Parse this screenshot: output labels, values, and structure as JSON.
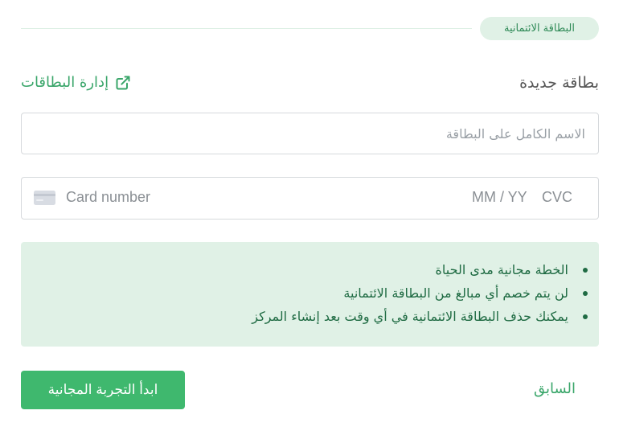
{
  "section": {
    "title": "البطاقة الائتمانية"
  },
  "header": {
    "new_card_title": "بطاقة جديدة",
    "manage_cards_link": "إدارة البطاقات"
  },
  "form": {
    "name_placeholder": "الاسم الكامل على البطاقة",
    "card_number_placeholder": "Card number",
    "expiry_placeholder": "MM / YY",
    "cvc_placeholder": "CVC"
  },
  "info": {
    "items": [
      "الخطة مجانية مدى الحياة",
      "لن يتم خصم أي مبالغ من البطاقة الائتمانية",
      "يمكنك حذف البطاقة الائتمانية في أي وقت بعد إنشاء المركز"
    ]
  },
  "actions": {
    "start_trial": "ابدأ التجربة المجانية",
    "previous": "السابق"
  },
  "colors": {
    "accent": "#3fb86e",
    "info_bg": "#e0f1e6",
    "info_text": "#1f6b43"
  },
  "icons": {
    "external_link": "external-link-icon",
    "credit_card": "credit-card-icon"
  }
}
